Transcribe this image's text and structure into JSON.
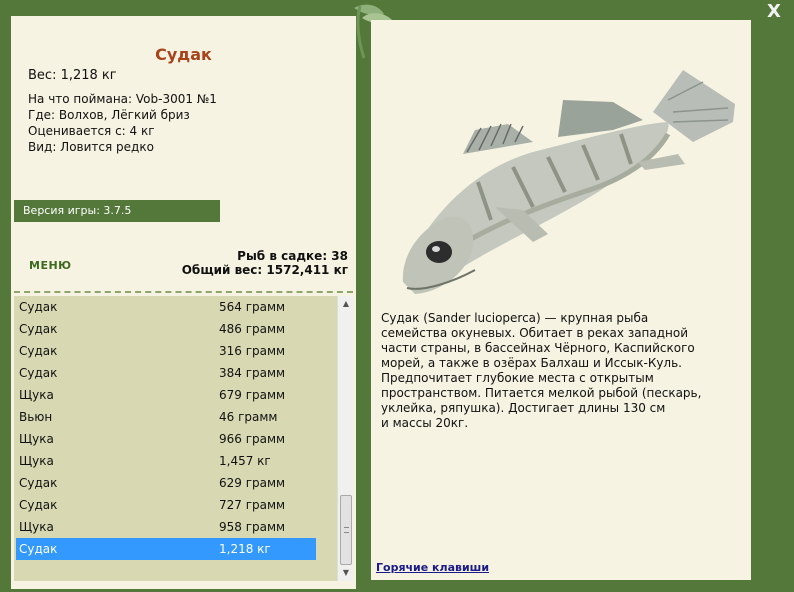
{
  "fish": {
    "name": "Судак",
    "weight_line": "Вес: 1,218 кг",
    "info": [
      "На что поймана: Vob-3001 №1",
      "Где: Волхов, Лёгкий бриз",
      "Оценивается с: 4 кг",
      "Вид: Ловится редко"
    ]
  },
  "version_label": "Версия игры: 3.7.5",
  "menu_label": "МЕНЮ",
  "stats": {
    "count_line": "Рыб в садке: 38",
    "total_line": "Общий вес: 1572,411 кг"
  },
  "catch": [
    {
      "name": "Судак",
      "weight": "564 грамм"
    },
    {
      "name": "Судак",
      "weight": "486 грамм"
    },
    {
      "name": "Судак",
      "weight": "316 грамм"
    },
    {
      "name": "Судак",
      "weight": "384 грамм"
    },
    {
      "name": "Щука",
      "weight": "679 грамм"
    },
    {
      "name": "Вьюн",
      "weight": "46 грамм"
    },
    {
      "name": "Щука",
      "weight": "966 грамм"
    },
    {
      "name": "Щука",
      "weight": "1,457 кг"
    },
    {
      "name": "Судак",
      "weight": "629 грамм"
    },
    {
      "name": "Судак",
      "weight": "727 грамм"
    },
    {
      "name": "Щука",
      "weight": "958 грамм"
    },
    {
      "name": "Судак",
      "weight": "1,218 кг"
    }
  ],
  "description": "Судак (Sander lucioperca) — крупная рыба\nсемейства окуневых. Обитает в реках западной\nчасти страны, в бассейнах Чёрного, Каспийского\nморей, а также в озёрах Балхаш и Иссык-Куль.\nПредпочитает глубокие места с открытым\nпространством. Питается мелкой рыбой (пескарь,\nуклейка, ряпушка). Достигает длины 130 см\nи массы 20кг.",
  "hotkeys_label": "Горячие клавиши",
  "close_label": "X",
  "colors": {
    "frame": "#53783a",
    "panel": "#f6f3e2",
    "list_bg": "#d8d9b2",
    "title": "#a8431a",
    "selected": "#3399ff",
    "link": "#1a1a8a"
  },
  "icons": {
    "close": "close-icon",
    "decoration": "leaf-icon",
    "scroll_up": "arrow-up-icon",
    "scroll_down": "arrow-down-icon"
  }
}
